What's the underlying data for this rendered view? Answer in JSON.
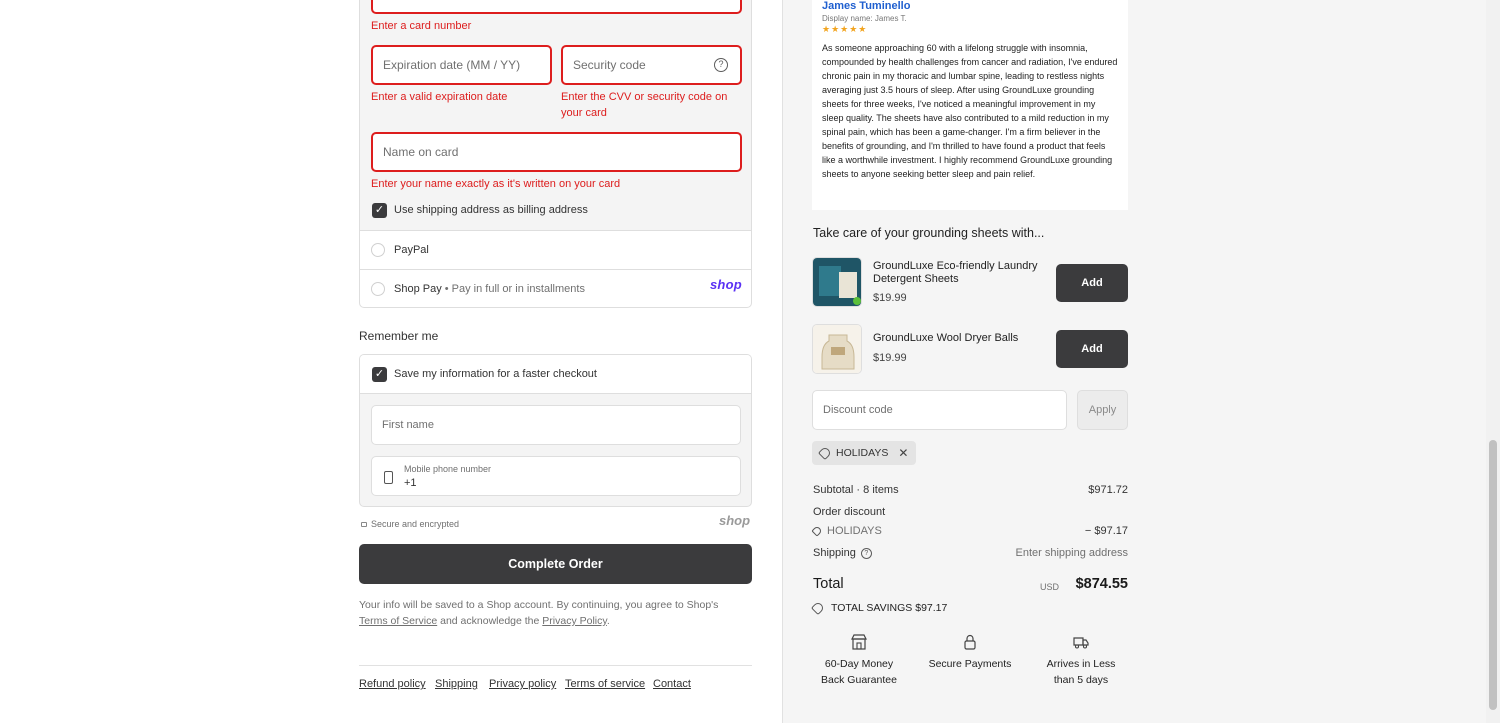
{
  "payment": {
    "card_number_error": "Enter a card number",
    "expiration_placeholder": "Expiration date (MM / YY)",
    "expiration_error": "Enter a valid expiration date",
    "security_placeholder": "Security code",
    "security_error_line1": "Enter the CVV or security code on",
    "security_error_line2": "your card",
    "name_placeholder": "Name on card",
    "name_error": "Enter your name exactly as it's written on your card",
    "billing_checkbox_label": "Use shipping address as billing address",
    "billing_checked": true,
    "paypal_label": "PayPal",
    "shoppay_label": "Shop Pay",
    "shoppay_sub": "• Pay in full or in installments",
    "shop_logo": "shop"
  },
  "remember": {
    "title": "Remember me",
    "save_label": "Save my information for a faster checkout",
    "save_checked": true,
    "first_name_placeholder": "First name",
    "phone_label": "Mobile phone number",
    "phone_prefix": "+1",
    "secure_text": "Secure and encrypted",
    "shop_logo": "shop"
  },
  "complete_button": "Complete Order",
  "consent": {
    "part1": "Your info will be saved to a Shop account. By continuing, you agree to Shop's",
    "terms": "Terms of Service",
    "part2": "and acknowledge the",
    "privacy": "Privacy Policy",
    "part3": "."
  },
  "footer_links": [
    "Refund policy",
    "Shipping",
    "Privacy policy",
    "Terms of service",
    "Contact"
  ],
  "review": {
    "name": "James Tuminello",
    "display_name": "Display name: James T.",
    "stars": "★★★★★",
    "rating": 5,
    "body": "As someone approaching 60 with a lifelong struggle with insomnia, compounded by health challenges from cancer and radiation, I've endured chronic pain in my thoracic and lumbar spine, leading to restless nights averaging just 3.5 hours of sleep. After using GroundLuxe grounding sheets for three weeks, I've noticed a meaningful improvement in my sleep quality. The sheets have also contributed to a mild reduction in my spinal pain, which has been a game-changer. I'm a firm believer in the benefits of grounding, and I'm thrilled to have found a product that feels like a worthwhile investment. I highly recommend GroundLuxe grounding sheets to anyone seeking better sleep and pain relief."
  },
  "upsell": {
    "title": "Take care of your grounding sheets with...",
    "items": [
      {
        "name": "GroundLuxe Eco-friendly Laundry Detergent Sheets",
        "price": "$19.99",
        "button": "Add"
      },
      {
        "name": "GroundLuxe Wool Dryer Balls",
        "price": "$19.99",
        "button": "Add"
      }
    ]
  },
  "discount": {
    "placeholder": "Discount code",
    "apply": "Apply",
    "applied_code": "HOLIDAYS"
  },
  "summary": {
    "subtotal_label": "Subtotal · 8 items",
    "subtotal_value": "$971.72",
    "order_discount_label": "Order discount",
    "discount_code": "HOLIDAYS",
    "discount_value": "− $97.17",
    "shipping_label": "Shipping",
    "shipping_value": "Enter shipping address",
    "total_label": "Total",
    "currency": "USD",
    "total_value": "$874.55",
    "savings_label": "TOTAL SAVINGS",
    "savings_value": "$97.17"
  },
  "trust": [
    {
      "icon": "store-icon",
      "line1": "60-Day Money",
      "line2": "Back Guarantee"
    },
    {
      "icon": "lock-icon",
      "line1": "Secure Payments",
      "line2": ""
    },
    {
      "icon": "truck-icon",
      "line1": "Arrives in Less",
      "line2": "than 5 days"
    }
  ],
  "colors": {
    "error": "#dd1d1d",
    "button": "#3b3b3d",
    "shop_purple": "#5a31f4",
    "review_name": "#1f5fcf",
    "stars": "#f2a41f"
  }
}
